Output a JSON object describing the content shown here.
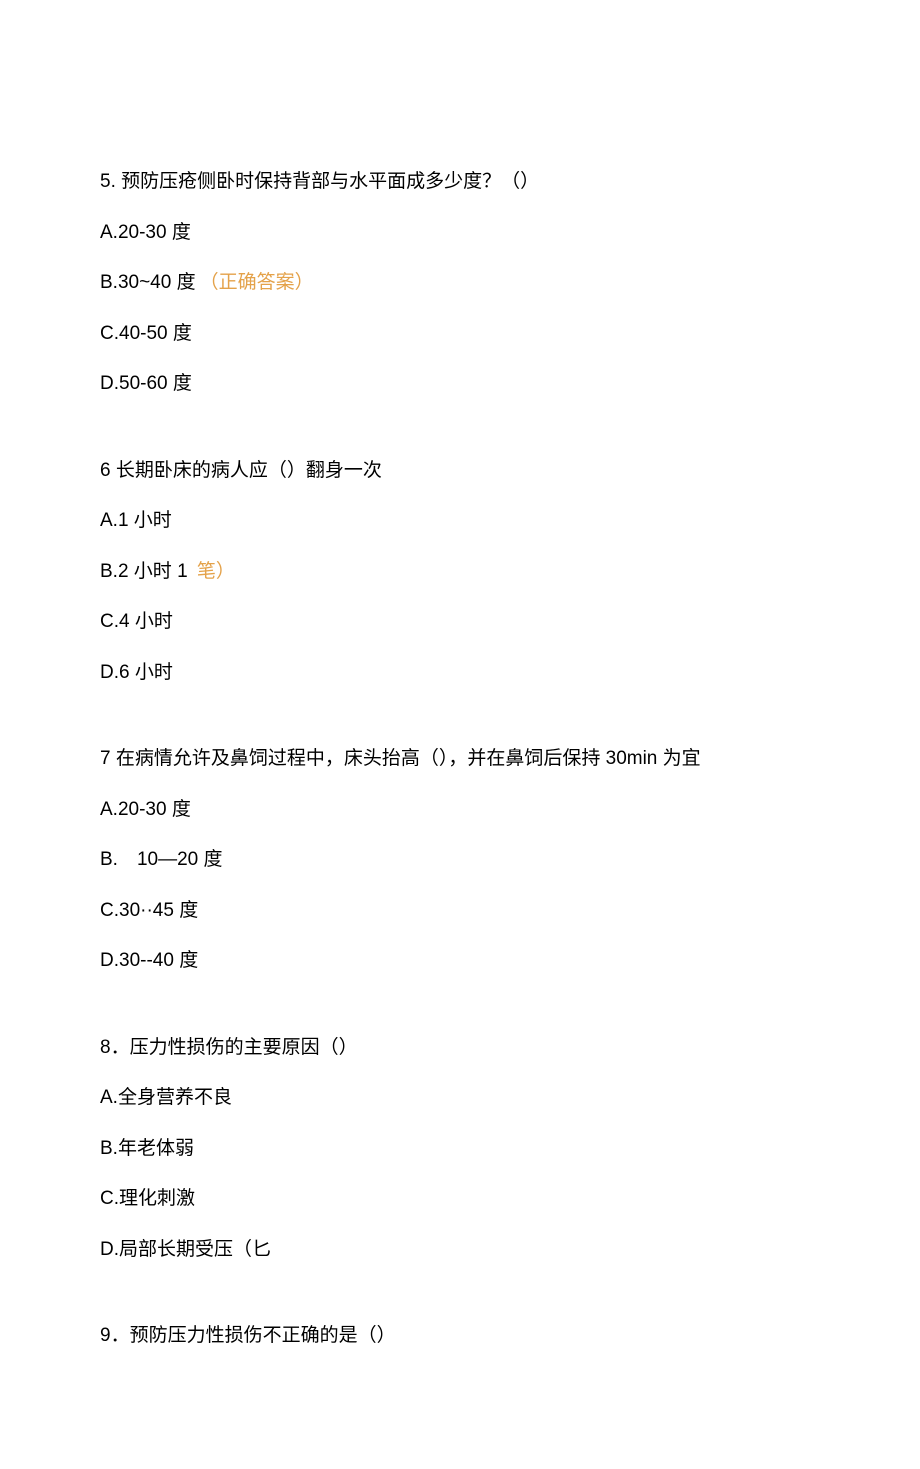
{
  "q5": {
    "stem": "5. 预防压疮侧卧时保持背部与水平面成多少度？（）",
    "optA": "A.20-30 度",
    "optB_text": "B.30~40 度",
    "optB_annot": "（正确答案）",
    "optC": "C.40-50 度",
    "optD": "D.50-60 度"
  },
  "q6": {
    "stem": "6 长期卧床的病人应（）翻身一次",
    "optA": "A.1 小时",
    "optB_text": "B.2 小时 1",
    "optB_annot": " 笔）",
    "optC": "C.4 小时",
    "optD": "D.6 小时"
  },
  "q7": {
    "stem": "7 在病情允许及鼻饲过程中，床头抬高（），并在鼻饲后保持 30min 为宜",
    "optA": "A.20-30 度",
    "optB": "B.　10—20 度",
    "optC": "C.30··45 度",
    "optD": "D.30--40 度"
  },
  "q8": {
    "stem": "8．压力性损伤的主要原因（）",
    "optA": "A.全身营养不良",
    "optB": "B.年老体弱",
    "optC": "C.理化刺激",
    "optD": "D.局部长期受压（匕"
  },
  "q9": {
    "stem": "9．预防压力性损伤不正确的是（）"
  }
}
